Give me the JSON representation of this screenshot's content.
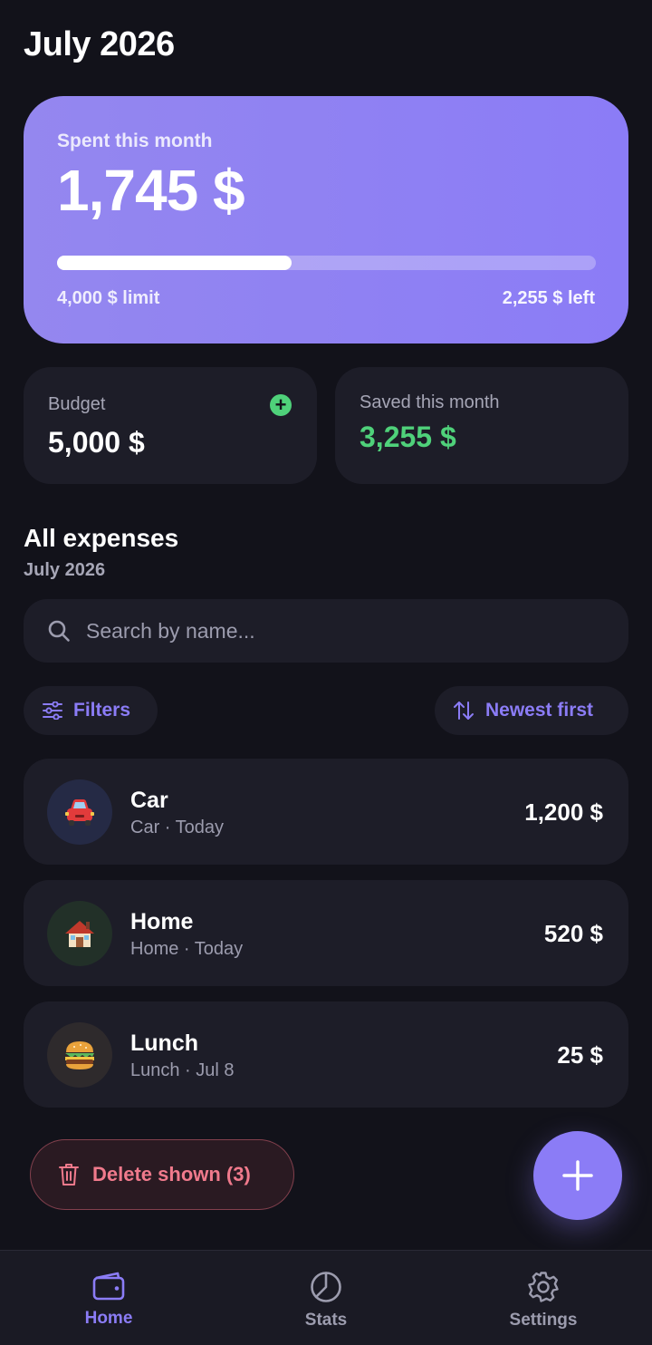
{
  "header": {
    "title": "July 2026"
  },
  "spend_card": {
    "label": "Spent this month",
    "amount": "1,745 $",
    "progress_fraction": 0.436,
    "limit_text": "4,000 $ limit",
    "left_text": "2,255 $ left"
  },
  "budget_card": {
    "label": "Budget",
    "value": "5,000 $",
    "add_icon": "plus-circle-icon"
  },
  "saved_card": {
    "label": "Saved this month",
    "value": "3,255 $"
  },
  "expenses_section": {
    "title": "All expenses",
    "subtitle": "July 2026"
  },
  "search": {
    "placeholder": "Search by name...",
    "value": ""
  },
  "filters": {
    "filters_label": "Filters",
    "sort_label": "Newest first"
  },
  "expenses": [
    {
      "name": "Car",
      "meta": "Car · Today",
      "amount": "1,200 $",
      "icon": "🚘",
      "icon_bg": "#252a45"
    },
    {
      "name": "Home",
      "meta": "Home · Today",
      "amount": "520 $",
      "icon": "🏠",
      "icon_bg": "#223028"
    },
    {
      "name": "Lunch",
      "meta": "Lunch · Jul 8",
      "amount": "25 $",
      "icon": "🍔",
      "icon_bg": "#2e2a2c"
    }
  ],
  "actions": {
    "delete_label": "Delete shown (3)",
    "add_icon": "plus-icon"
  },
  "nav": [
    {
      "label": "Home",
      "icon": "wallet-icon",
      "active": true
    },
    {
      "label": "Stats",
      "icon": "pie-chart-icon",
      "active": false
    },
    {
      "label": "Settings",
      "icon": "gear-icon",
      "active": false
    }
  ],
  "colors": {
    "accent": "#8b7cf6",
    "positive": "#4fd17a",
    "danger": "#f07a8c",
    "background": "#12121a",
    "card": "#1d1d28"
  }
}
